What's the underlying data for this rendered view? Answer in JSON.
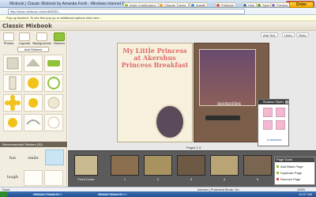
{
  "window": {
    "title": "Mixbook | Classic Mixbook by Amanda Fordi - Windows Internet Explorer",
    "url": "http://www.mixbook.com/edit/5280...",
    "popup_notice": "Pop-up blocked. To see this pop-up or additional options click here..."
  },
  "app": {
    "logo": "Classic Mixbook",
    "header_buttons": [
      "Invite Contributors!",
      "Change Theme",
      "Autofill",
      "Publicize",
      "Help",
      "Save",
      "Preview"
    ],
    "order_label": "Order"
  },
  "left_panel": {
    "tabs": [
      "Photos",
      "Layouts",
      "Backgrounds",
      "Stickers"
    ],
    "add_button": "Add Stickers",
    "recommended_header": "Recommended Stickers (20)",
    "words": [
      "fun",
      "smile",
      "laugh"
    ]
  },
  "workspace": {
    "buttons": [
      "Add Text",
      "Undo",
      "Redo"
    ],
    "page_title": "My Little Princess at Akershus Princess Breakfast",
    "caption": "memories",
    "page_nav": "Pages 2-3"
  },
  "shadow_popup": {
    "title": "Shadow Styles",
    "customize": "Customize"
  },
  "page_tools": {
    "title": "Page Tools",
    "items": [
      "Add Blank Page",
      "Duplicate Page",
      "Remove Page"
    ]
  },
  "filmstrip": {
    "labels": [
      "Front Cover",
      "1",
      "2",
      "3",
      "4",
      "5"
    ]
  },
  "status": {
    "text": "Done",
    "zone": "Internet | Protected Mode: On",
    "zoom": "100%"
  },
  "taskbar": {
    "items": [
      "Mixbook | Classic M...",
      "Blogger: Disney Gi..."
    ],
    "clock": "10:37 AM"
  }
}
